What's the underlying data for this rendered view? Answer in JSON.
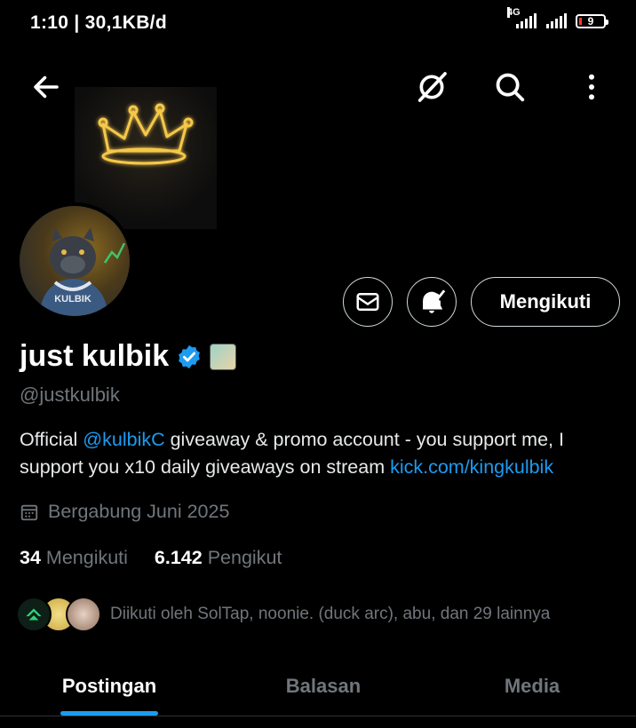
{
  "status_bar": {
    "time": "1:10 | 30,1KB/d",
    "network": "4G",
    "battery": "9"
  },
  "header": {
    "back_icon": "arrow-left-icon",
    "icons": [
      "mute-icon",
      "search-icon",
      "more-vertical-icon"
    ]
  },
  "profile": {
    "display_name": "just kulbik",
    "handle": "@justkulbik",
    "bio_prefix": "Official ",
    "bio_mention": "@kulbikC",
    "bio_middle": " giveaway & promo account - you support me, I support you x10  daily giveaways on stream ",
    "bio_link": "kick.com/kingkulbik",
    "joined": "Bergabung Juni 2025",
    "following_count": "34",
    "following_label": "Mengikuti",
    "followers_count": "6.142",
    "followers_label": "Pengikut",
    "followed_by": "Diikuti oleh SolTap, noonie. (duck arc), abu, dan 29 lainnya",
    "avatar_caption": "KULBIK"
  },
  "actions": {
    "follow_label": "Mengikuti"
  },
  "tabs": [
    {
      "label": "Postingan",
      "active": true
    },
    {
      "label": "Balasan",
      "active": false
    },
    {
      "label": "Media",
      "active": false
    }
  ],
  "colors": {
    "background": "#000000",
    "accent": "#1d9bf0",
    "muted": "#71767b",
    "verified": "#1d9bf0"
  }
}
